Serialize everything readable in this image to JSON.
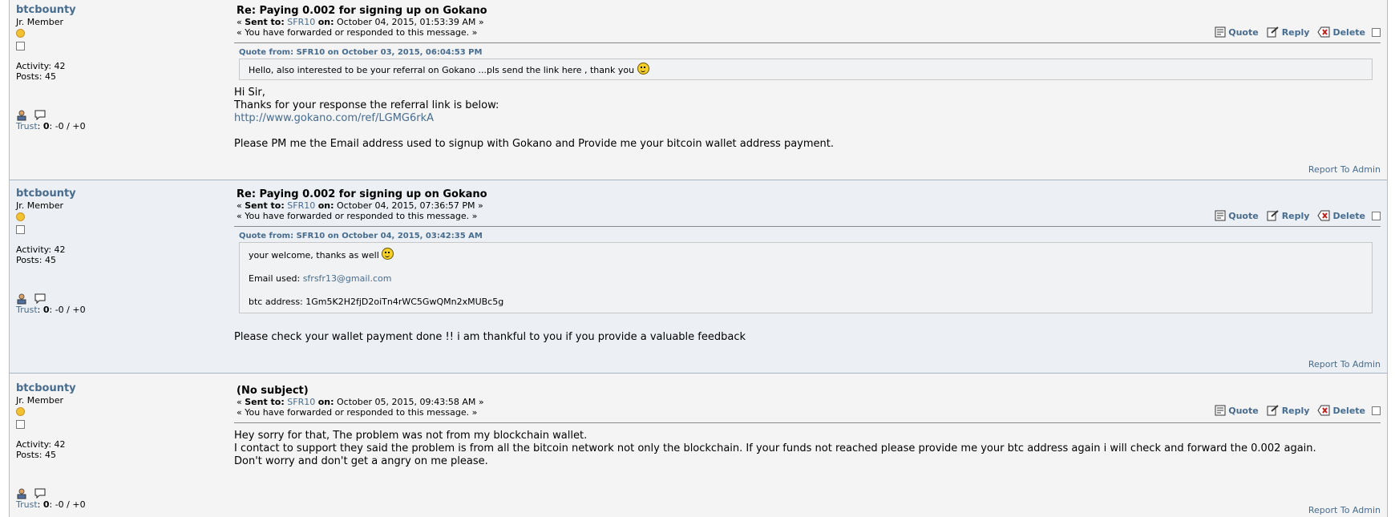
{
  "posts": [
    {
      "username": "btcbounty",
      "rank": "Jr. Member",
      "activity": "Activity: 42",
      "posts": "Posts: 45",
      "trust_label": "Trust",
      "trust_value": "0",
      "trust_rest": ": -0 / +0",
      "subject": "Re: Paying 0.002 for signing up on Gokano",
      "sent_to_label": "Sent to:",
      "sent_to_user": "SFR10",
      "on_label": "on:",
      "date": "October 04, 2015, 01:53:39 AM",
      "forwarded": "You have forwarded or responded to this message.",
      "quote_header": "Quote from: SFR10 on October 03, 2015, 06:04:53 PM",
      "quote_lines": [
        "Hello, also interested to be your referral on Gokano ...pls send the link here , thank you"
      ],
      "body_lines": [
        "Hi Sir,",
        "Thanks for your response the referral link is below:"
      ],
      "body_link": "http://www.gokano.com/ref/LGMG6rkA",
      "body_after": "Please PM me the Email address used to signup with Gokano and Provide me your bitcoin wallet address payment.",
      "report": "Report To Admin"
    },
    {
      "username": "btcbounty",
      "rank": "Jr. Member",
      "activity": "Activity: 42",
      "posts": "Posts: 45",
      "trust_label": "Trust",
      "trust_value": "0",
      "trust_rest": ": -0 / +0",
      "subject": "Re: Paying 0.002 for signing up on Gokano",
      "sent_to_label": "Sent to:",
      "sent_to_user": "SFR10",
      "on_label": "on:",
      "date": "October 04, 2015, 07:36:57 PM",
      "forwarded": "You have forwarded or responded to this message.",
      "quote_header": "Quote from: SFR10 on October 04, 2015, 03:42:35 AM",
      "quote_line1": "your welcome, thanks as well",
      "quote_email_label": "Email used:",
      "quote_email": "sfrsfr13@gmail.com",
      "quote_btc": "btc address: 1Gm5K2H2fjD2oiTn4rWC5GwQMn2xMUBc5g",
      "body": "Please check your wallet payment done !! i am thankful to you if you provide a valuable feedback",
      "report": "Report To Admin"
    },
    {
      "username": "btcbounty",
      "rank": "Jr. Member",
      "activity": "Activity: 42",
      "posts": "Posts: 45",
      "trust_label": "Trust",
      "trust_value": "0",
      "trust_rest": ": -0 / +0",
      "subject": "(No subject)",
      "sent_to_label": "Sent to:",
      "sent_to_user": "SFR10",
      "on_label": "on:",
      "date": "October 05, 2015, 09:43:58 AM",
      "forwarded": "You have forwarded or responded to this message.",
      "body_lines": [
        "Hey sorry for that, The problem was not from my blockchain wallet.",
        "I contact to support they said the problem is from all the bitcoin network not only the blockchain. If your funds not reached please provide me your btc address again i will check and forward the 0.002 again.",
        "Don't worry and don't get a angry on me please."
      ],
      "report": "Report To Admin"
    }
  ],
  "actions": {
    "quote": "Quote",
    "reply": "Reply",
    "delete": "Delete"
  },
  "colors": {
    "link": "#476c8e",
    "post_bg_1": "#f4f4f4",
    "post_bg_2": "#eceff3"
  },
  "icons": [
    "quote-icon",
    "reply-icon",
    "delete-icon",
    "profile-icon",
    "message-icon",
    "rank-coin-icon"
  ]
}
